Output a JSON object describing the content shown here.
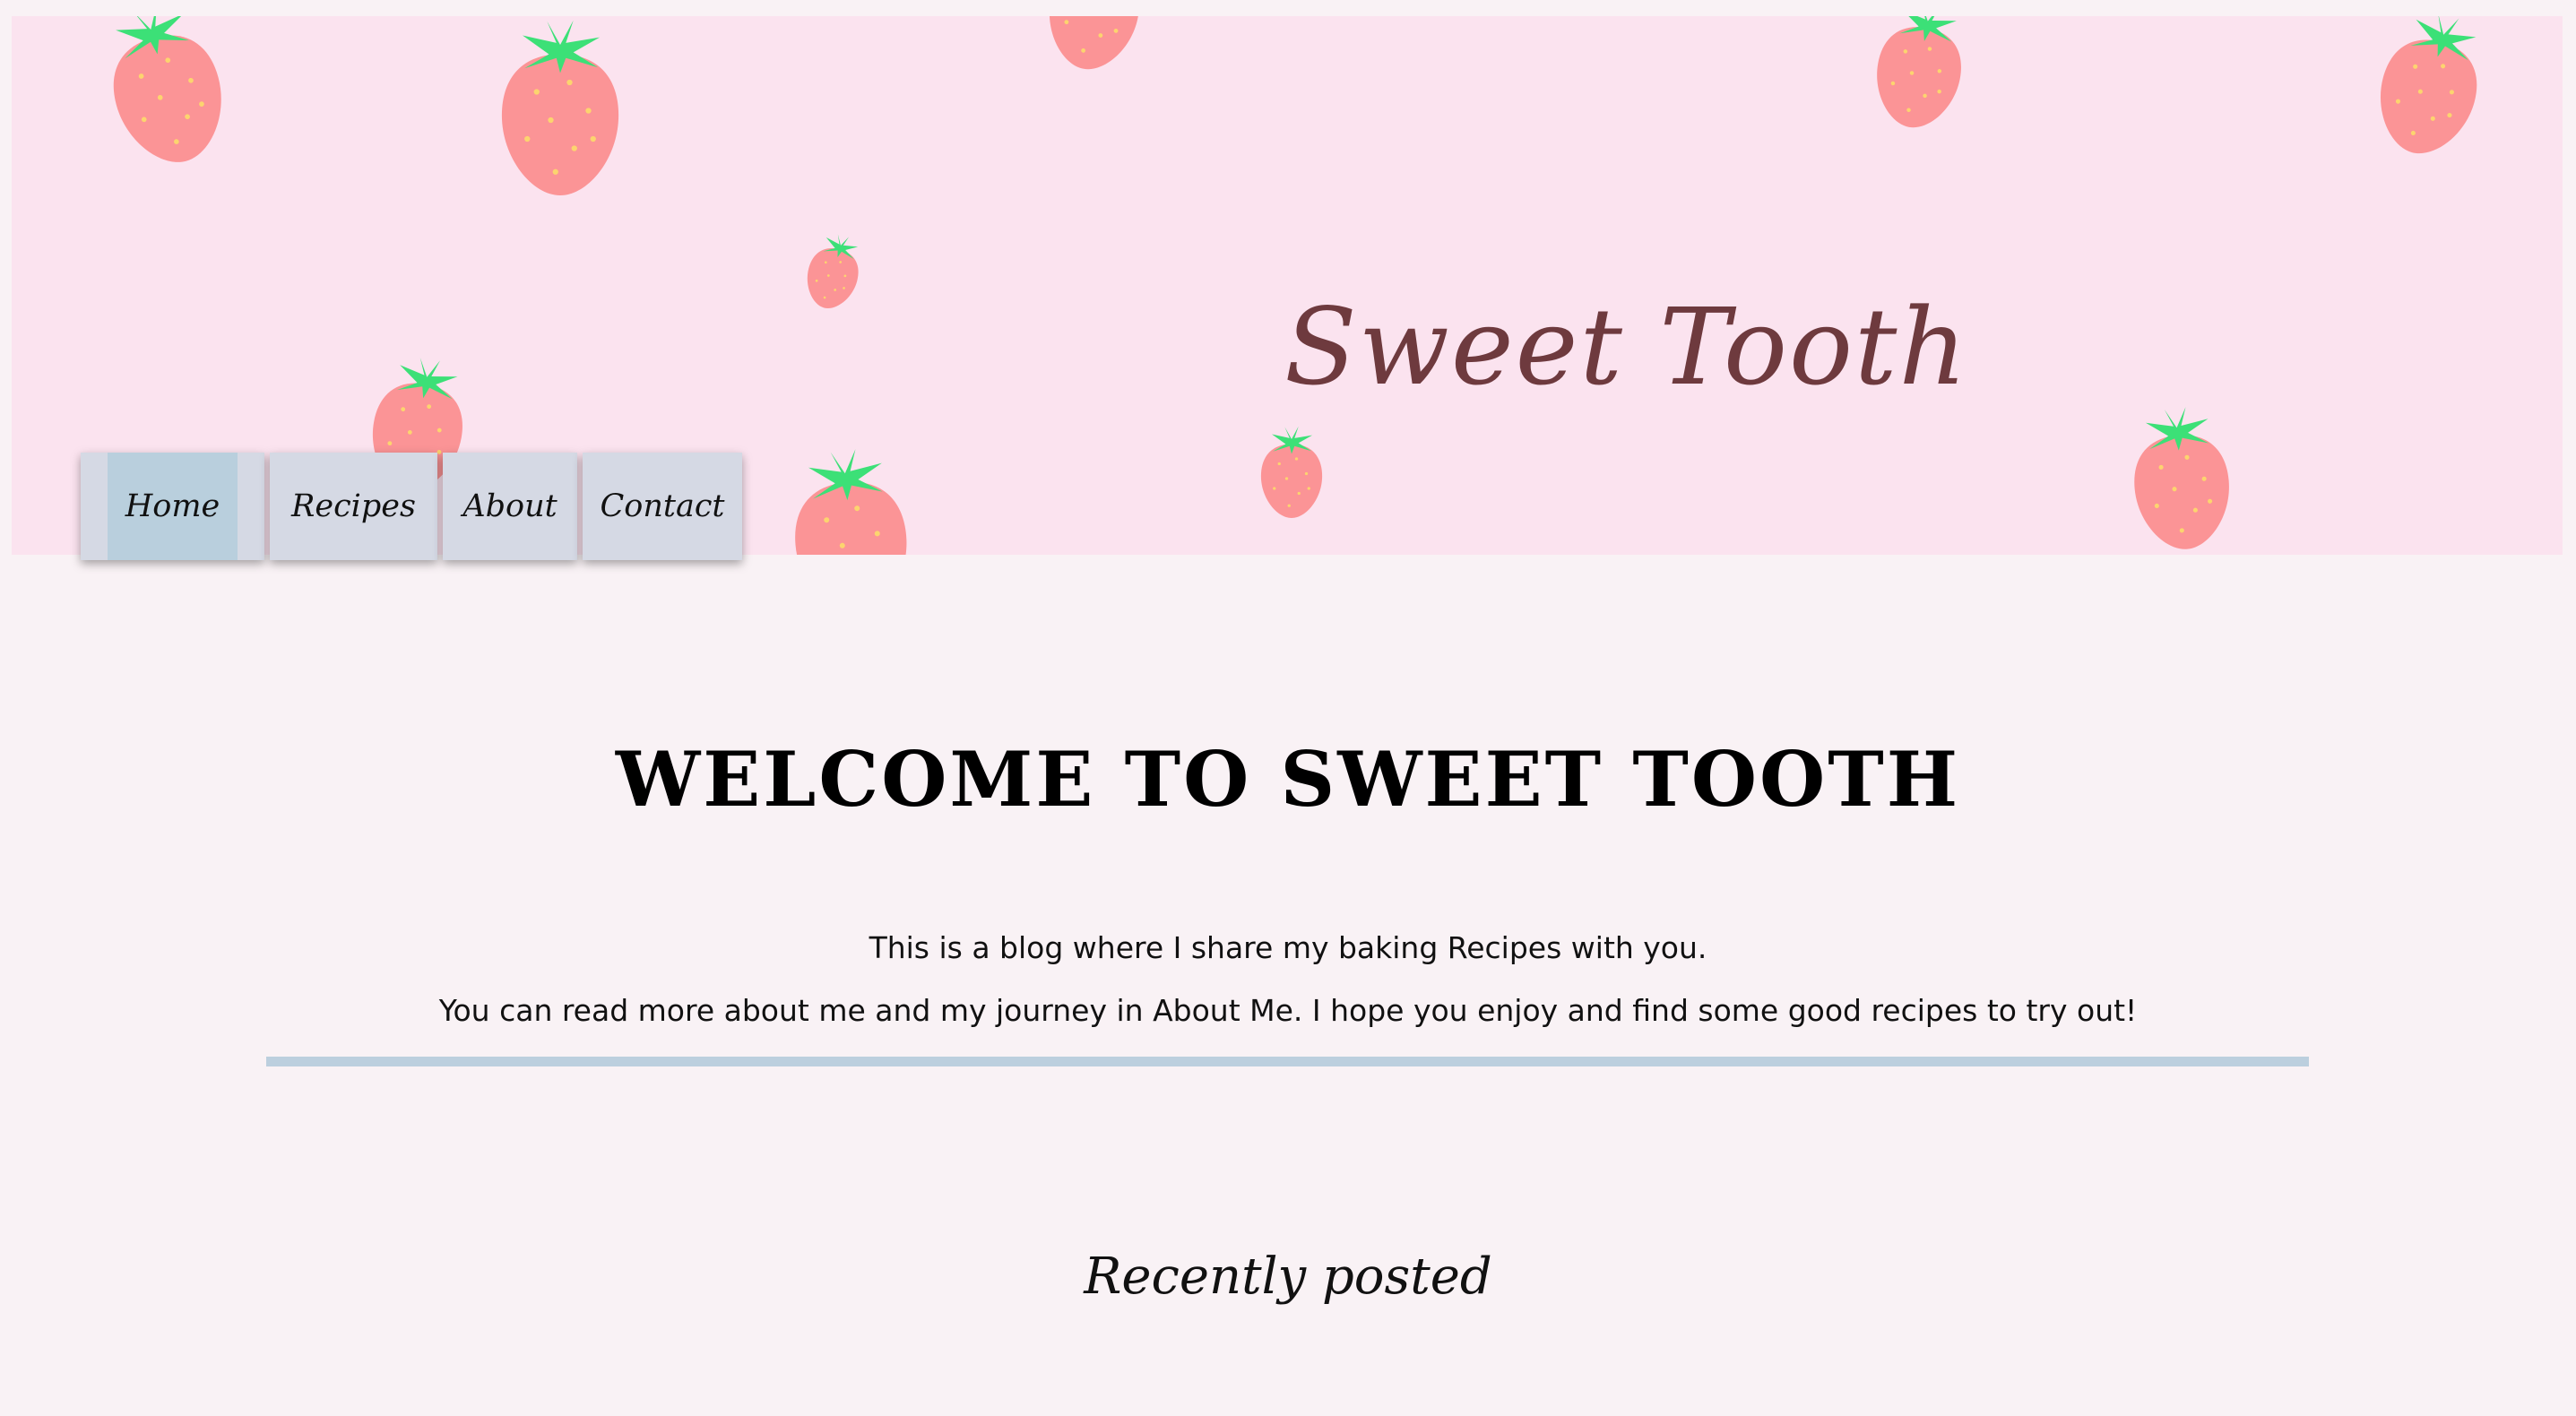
{
  "banner": {
    "title": "Sweet Tooth",
    "background_color": "#fbe3ef",
    "title_color": "#6e3a3e",
    "decoration": "strawberry-pattern"
  },
  "nav": {
    "items": [
      {
        "label": "Home",
        "active": true
      },
      {
        "label": "Recipes",
        "active": false
      },
      {
        "label": "About",
        "active": false
      },
      {
        "label": "Contact",
        "active": false
      }
    ],
    "item_color": "#d5d9e4",
    "active_color": "#b9cfdd"
  },
  "main": {
    "heading": "WELCOME TO SWEET TOOTH",
    "intro_line_1": "This is a blog where I share my baking Recipes with you.",
    "intro_line_2": "You can read more about me and my journey in About Me. I hope you enjoy and find some good recipes to try out!",
    "divider_color": "#bccfde",
    "recent_heading": "Recently posted"
  },
  "page": {
    "background_color": "#f9f2f5"
  }
}
